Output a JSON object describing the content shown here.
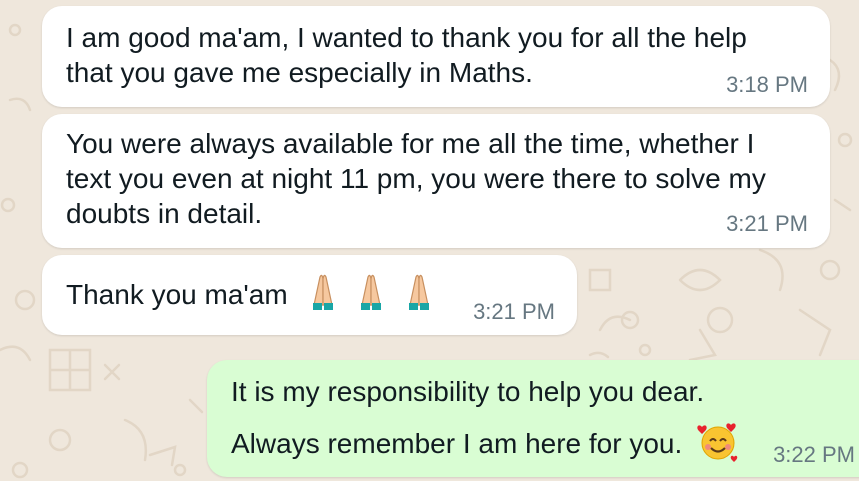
{
  "chat": {
    "messages": [
      {
        "direction": "incoming",
        "text": "I am good ma'am, I wanted to thank you for all the help that you gave me especially in Maths.",
        "time": "3:18 PM"
      },
      {
        "direction": "incoming",
        "text": "You were always available for me all the time, whether I text you even at night 11 pm, you were there to solve my doubts in detail.",
        "time": "3:21 PM"
      },
      {
        "direction": "incoming",
        "text": "Thank you ma'am",
        "emoji": [
          "folded-hands-icon",
          "folded-hands-icon",
          "folded-hands-icon"
        ],
        "time": "3:21 PM"
      },
      {
        "direction": "outgoing",
        "text_line1": "It is my responsibility to help you dear.",
        "text_line2": "Always remember I am here for you.",
        "emoji": [
          "smiling-face-with-hearts-icon"
        ],
        "time": "3:22 PM"
      }
    ]
  },
  "colors": {
    "wallpaper": "#efe7dc",
    "incoming_bubble": "#ffffff",
    "outgoing_bubble": "#d9fdd3",
    "timestamp": "#667781",
    "text": "#111b21"
  }
}
